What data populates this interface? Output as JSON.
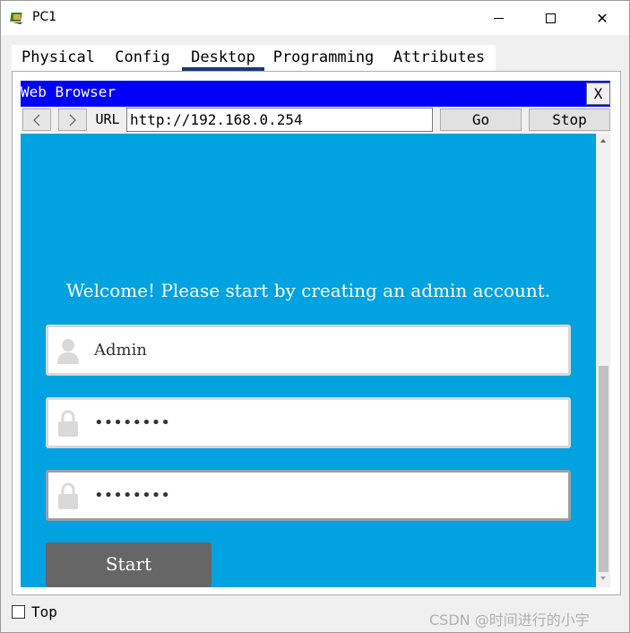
{
  "window": {
    "title": "PC1",
    "icon": "packet-tracer-pc-icon",
    "controls": [
      "minimize-icon",
      "maximize-icon",
      "close-icon"
    ],
    "close_glyph": "✕"
  },
  "tabs": [
    {
      "label": "Physical",
      "active": false
    },
    {
      "label": "Config",
      "active": false
    },
    {
      "label": "Desktop",
      "active": true
    },
    {
      "label": "Programming",
      "active": false
    },
    {
      "label": "Attributes",
      "active": false
    }
  ],
  "browser": {
    "title": "Web Browser",
    "close_label": "X",
    "back_glyph": "<",
    "forward_glyph": ">",
    "url_label": "URL",
    "url_value": "http://192.168.0.254",
    "go_label": "Go",
    "stop_label": "Stop"
  },
  "page": {
    "welcome": "Welcome! Please start by creating an admin account.",
    "username_value": "Admin",
    "password_value": "••••••••",
    "confirm_value": "••••••••",
    "start_label": "Start"
  },
  "footer": {
    "top_label": "Top",
    "watermark": "CSDN @时间进行的小宇"
  },
  "colors": {
    "browser_header": "#0000ff",
    "page_background": "#00a2e0",
    "start_button": "#666666",
    "active_tab_underline": "#1b3a6b"
  }
}
